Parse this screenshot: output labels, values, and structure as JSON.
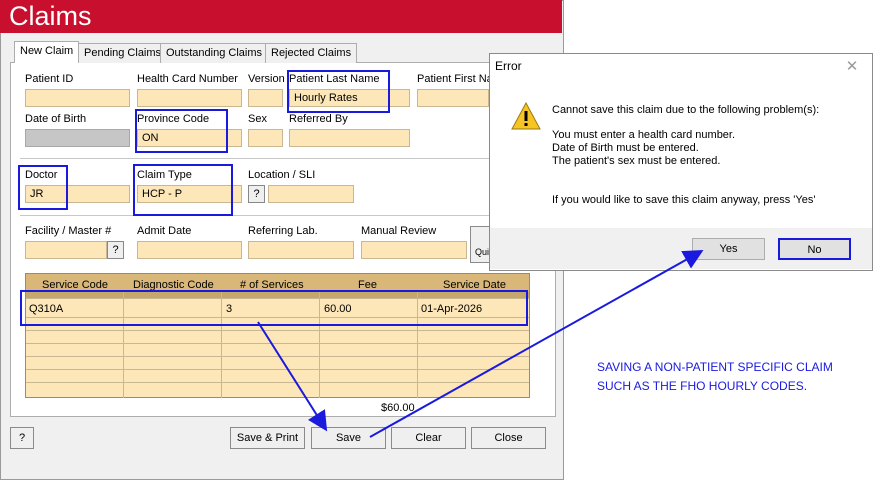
{
  "window": {
    "title": "Claims"
  },
  "tabs": [
    {
      "label": "New Claim"
    },
    {
      "label": "Pending Claims"
    },
    {
      "label": "Outstanding Claims"
    },
    {
      "label": "Rejected Claims"
    }
  ],
  "patient": {
    "patient_id_label": "Patient ID",
    "patient_id_value": "",
    "health_card_label": "Health Card Number",
    "health_card_value": "",
    "version_label": "Version",
    "version_value": "",
    "last_name_label": "Patient Last Name",
    "last_name_value": "Hourly Rates",
    "first_name_label": "Patient First Na",
    "first_name_value": "",
    "dob_label": "Date of Birth",
    "province_label": "Province Code",
    "province_value": "ON",
    "sex_label": "Sex",
    "sex_value": "",
    "referred_by_label": "Referred By",
    "referred_by_value": ""
  },
  "claim": {
    "doctor_label": "Doctor",
    "doctor_value": "JR",
    "claim_type_label": "Claim Type",
    "claim_type_value": "HCP - P",
    "location_label": "Location / SLI",
    "location_value": "",
    "lookup_button": "?",
    "facility_label": "Facility / Master #",
    "facility_value": "",
    "admit_date_label": "Admit Date",
    "admit_date_value": "",
    "referring_lab_label": "Referring Lab.",
    "referring_lab_value": "",
    "manual_review_label": "Manual Review",
    "manual_review_value": "",
    "quick_button": "Qui"
  },
  "grid": {
    "columns": [
      "Service Code",
      "Diagnostic Code",
      "# of Services",
      "Fee",
      "Service Date"
    ],
    "rows": [
      {
        "service_code": "Q310A",
        "diagnostic_code": "",
        "services": "3",
        "fee": "60.00",
        "service_date": "01-Apr-2026"
      }
    ],
    "total": "$60.00"
  },
  "buttons": {
    "help": "?",
    "save_print": "Save & Print",
    "save": "Save",
    "clear": "Clear",
    "close": "Close"
  },
  "error_dialog": {
    "title": "Error",
    "close_glyph": "✕",
    "icon": "warning-icon",
    "line1": "Cannot save this claim due to the following problem(s):",
    "line2": "You must enter a health card number.",
    "line3": "Date of Birth must be entered.",
    "line4": "The patient's sex must be entered.",
    "line5": "If you would like to save this claim anyway, press 'Yes'",
    "yes": "Yes",
    "no": "No"
  },
  "annotation": {
    "note": "SAVING A NON-PATIENT SPECIFIC CLAIM SUCH AS THE FHO HOURLY CODES."
  },
  "colors": {
    "title_bar": "#c8102e",
    "field": "#fde7b8",
    "grid_header": "#d8b778",
    "highlight": "#1a1adf"
  }
}
